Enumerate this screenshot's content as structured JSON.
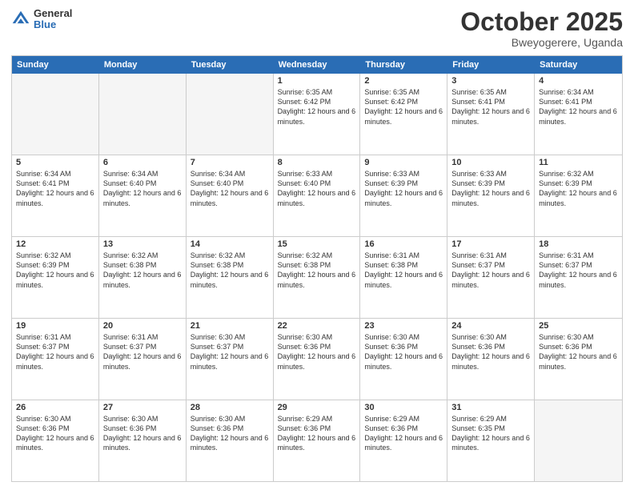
{
  "logo": {
    "general": "General",
    "blue": "Blue"
  },
  "header": {
    "month": "October 2025",
    "location": "Bweyogerere, Uganda"
  },
  "weekdays": [
    "Sunday",
    "Monday",
    "Tuesday",
    "Wednesday",
    "Thursday",
    "Friday",
    "Saturday"
  ],
  "rows": [
    [
      {
        "day": "",
        "info": "",
        "empty": true
      },
      {
        "day": "",
        "info": "",
        "empty": true
      },
      {
        "day": "",
        "info": "",
        "empty": true
      },
      {
        "day": "1",
        "info": "Sunrise: 6:35 AM\nSunset: 6:42 PM\nDaylight: 12 hours\nand 6 minutes."
      },
      {
        "day": "2",
        "info": "Sunrise: 6:35 AM\nSunset: 6:42 PM\nDaylight: 12 hours\nand 6 minutes."
      },
      {
        "day": "3",
        "info": "Sunrise: 6:35 AM\nSunset: 6:41 PM\nDaylight: 12 hours\nand 6 minutes."
      },
      {
        "day": "4",
        "info": "Sunrise: 6:34 AM\nSunset: 6:41 PM\nDaylight: 12 hours\nand 6 minutes."
      }
    ],
    [
      {
        "day": "5",
        "info": "Sunrise: 6:34 AM\nSunset: 6:41 PM\nDaylight: 12 hours\nand 6 minutes."
      },
      {
        "day": "6",
        "info": "Sunrise: 6:34 AM\nSunset: 6:40 PM\nDaylight: 12 hours\nand 6 minutes."
      },
      {
        "day": "7",
        "info": "Sunrise: 6:34 AM\nSunset: 6:40 PM\nDaylight: 12 hours\nand 6 minutes."
      },
      {
        "day": "8",
        "info": "Sunrise: 6:33 AM\nSunset: 6:40 PM\nDaylight: 12 hours\nand 6 minutes."
      },
      {
        "day": "9",
        "info": "Sunrise: 6:33 AM\nSunset: 6:39 PM\nDaylight: 12 hours\nand 6 minutes."
      },
      {
        "day": "10",
        "info": "Sunrise: 6:33 AM\nSunset: 6:39 PM\nDaylight: 12 hours\nand 6 minutes."
      },
      {
        "day": "11",
        "info": "Sunrise: 6:32 AM\nSunset: 6:39 PM\nDaylight: 12 hours\nand 6 minutes."
      }
    ],
    [
      {
        "day": "12",
        "info": "Sunrise: 6:32 AM\nSunset: 6:39 PM\nDaylight: 12 hours\nand 6 minutes."
      },
      {
        "day": "13",
        "info": "Sunrise: 6:32 AM\nSunset: 6:38 PM\nDaylight: 12 hours\nand 6 minutes."
      },
      {
        "day": "14",
        "info": "Sunrise: 6:32 AM\nSunset: 6:38 PM\nDaylight: 12 hours\nand 6 minutes."
      },
      {
        "day": "15",
        "info": "Sunrise: 6:32 AM\nSunset: 6:38 PM\nDaylight: 12 hours\nand 6 minutes."
      },
      {
        "day": "16",
        "info": "Sunrise: 6:31 AM\nSunset: 6:38 PM\nDaylight: 12 hours\nand 6 minutes."
      },
      {
        "day": "17",
        "info": "Sunrise: 6:31 AM\nSunset: 6:37 PM\nDaylight: 12 hours\nand 6 minutes."
      },
      {
        "day": "18",
        "info": "Sunrise: 6:31 AM\nSunset: 6:37 PM\nDaylight: 12 hours\nand 6 minutes."
      }
    ],
    [
      {
        "day": "19",
        "info": "Sunrise: 6:31 AM\nSunset: 6:37 PM\nDaylight: 12 hours\nand 6 minutes."
      },
      {
        "day": "20",
        "info": "Sunrise: 6:31 AM\nSunset: 6:37 PM\nDaylight: 12 hours\nand 6 minutes."
      },
      {
        "day": "21",
        "info": "Sunrise: 6:30 AM\nSunset: 6:37 PM\nDaylight: 12 hours\nand 6 minutes."
      },
      {
        "day": "22",
        "info": "Sunrise: 6:30 AM\nSunset: 6:36 PM\nDaylight: 12 hours\nand 6 minutes."
      },
      {
        "day": "23",
        "info": "Sunrise: 6:30 AM\nSunset: 6:36 PM\nDaylight: 12 hours\nand 6 minutes."
      },
      {
        "day": "24",
        "info": "Sunrise: 6:30 AM\nSunset: 6:36 PM\nDaylight: 12 hours\nand 6 minutes."
      },
      {
        "day": "25",
        "info": "Sunrise: 6:30 AM\nSunset: 6:36 PM\nDaylight: 12 hours\nand 6 minutes."
      }
    ],
    [
      {
        "day": "26",
        "info": "Sunrise: 6:30 AM\nSunset: 6:36 PM\nDaylight: 12 hours\nand 6 minutes."
      },
      {
        "day": "27",
        "info": "Sunrise: 6:30 AM\nSunset: 6:36 PM\nDaylight: 12 hours\nand 6 minutes."
      },
      {
        "day": "28",
        "info": "Sunrise: 6:30 AM\nSunset: 6:36 PM\nDaylight: 12 hours\nand 6 minutes."
      },
      {
        "day": "29",
        "info": "Sunrise: 6:29 AM\nSunset: 6:36 PM\nDaylight: 12 hours\nand 6 minutes."
      },
      {
        "day": "30",
        "info": "Sunrise: 6:29 AM\nSunset: 6:36 PM\nDaylight: 12 hours\nand 6 minutes."
      },
      {
        "day": "31",
        "info": "Sunrise: 6:29 AM\nSunset: 6:35 PM\nDaylight: 12 hours\nand 6 minutes."
      },
      {
        "day": "",
        "info": "",
        "empty": true
      }
    ]
  ]
}
